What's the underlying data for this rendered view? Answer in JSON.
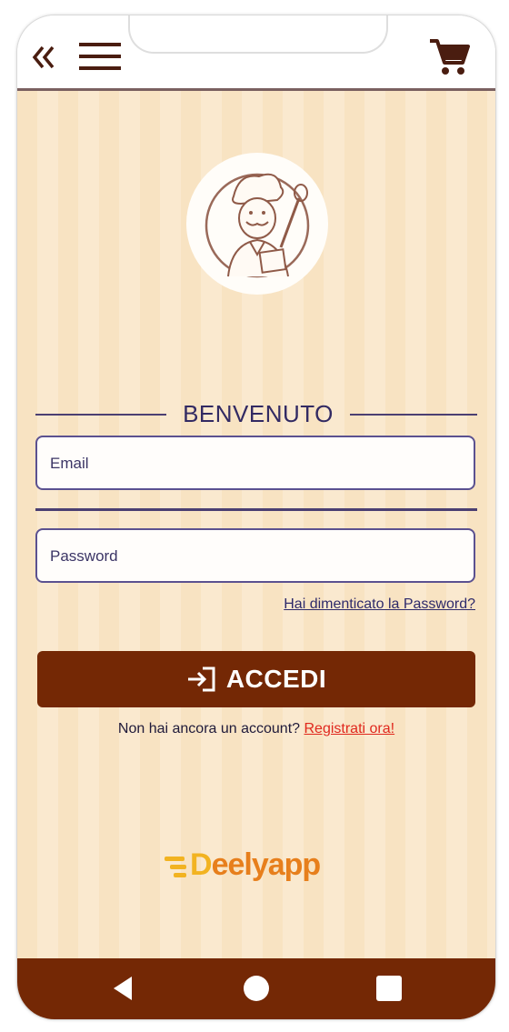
{
  "header": {
    "back_icon": "double-chevron-left-icon",
    "menu_icon": "hamburger-icon",
    "cart_icon": "shopping-cart-icon"
  },
  "logo": {
    "icon": "chef-illustration-icon"
  },
  "welcome": {
    "title": "BENVENUTO"
  },
  "form": {
    "email_placeholder": "Email",
    "password_placeholder": "Password",
    "forgot_password": "Hai dimenticato la Password?",
    "login_label": "ACCEDI",
    "login_icon": "sign-in-icon",
    "no_account_text": "Non hai ancora un account?",
    "register_link": "Registrati ora!"
  },
  "brand": {
    "name": "Deelyapp",
    "d": "D",
    "rest": "eelyapp"
  },
  "navbar": {
    "back_icon": "triangle-back-icon",
    "home_icon": "circle-home-icon",
    "recents_icon": "square-recents-icon"
  },
  "colors": {
    "primary": "#742805",
    "stripe_light": "#fae9cf",
    "stripe_dark": "#f8e3c2",
    "text_dark": "#322a63",
    "link_red": "#e0281e",
    "brand_yellow": "#f2b321",
    "brand_orange": "#e77f1c"
  }
}
